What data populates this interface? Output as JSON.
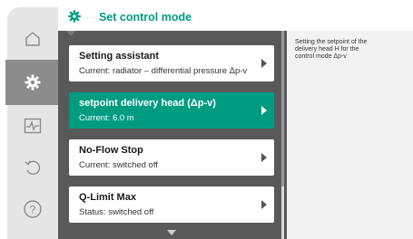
{
  "header": {
    "title": "Set control mode",
    "breadcrumb_dots": "···",
    "icon": "gear-icon"
  },
  "sidebar": {
    "items": [
      {
        "name": "home-icon",
        "active": false
      },
      {
        "name": "settings-gear-icon",
        "active": true
      },
      {
        "name": "diagnostics-monitor-icon",
        "active": false
      },
      {
        "name": "restore-icon",
        "active": false
      },
      {
        "name": "help-icon",
        "active": false
      }
    ]
  },
  "menu": {
    "items": [
      {
        "label": "Setting assistant",
        "sub": "Current: radiator – differential pressure Δp-v",
        "selected": false
      },
      {
        "label": "setpoint delivery head (Δp-v)",
        "sub": "Current: 6.0 m",
        "selected": true
      },
      {
        "label": "No-Flow Stop",
        "sub": "Current: switched off",
        "selected": false
      },
      {
        "label": "Q-Limit Max",
        "sub": "Status: switched off",
        "selected": false
      }
    ]
  },
  "help": {
    "text": "Setting the setpoint of the delivery head H for the control mode Δp-v"
  },
  "colors": {
    "accent": "#009c82",
    "content_bg": "#595959",
    "sidebar_bg": "#e6e6e6",
    "help_bg": "#f2f2f2"
  }
}
